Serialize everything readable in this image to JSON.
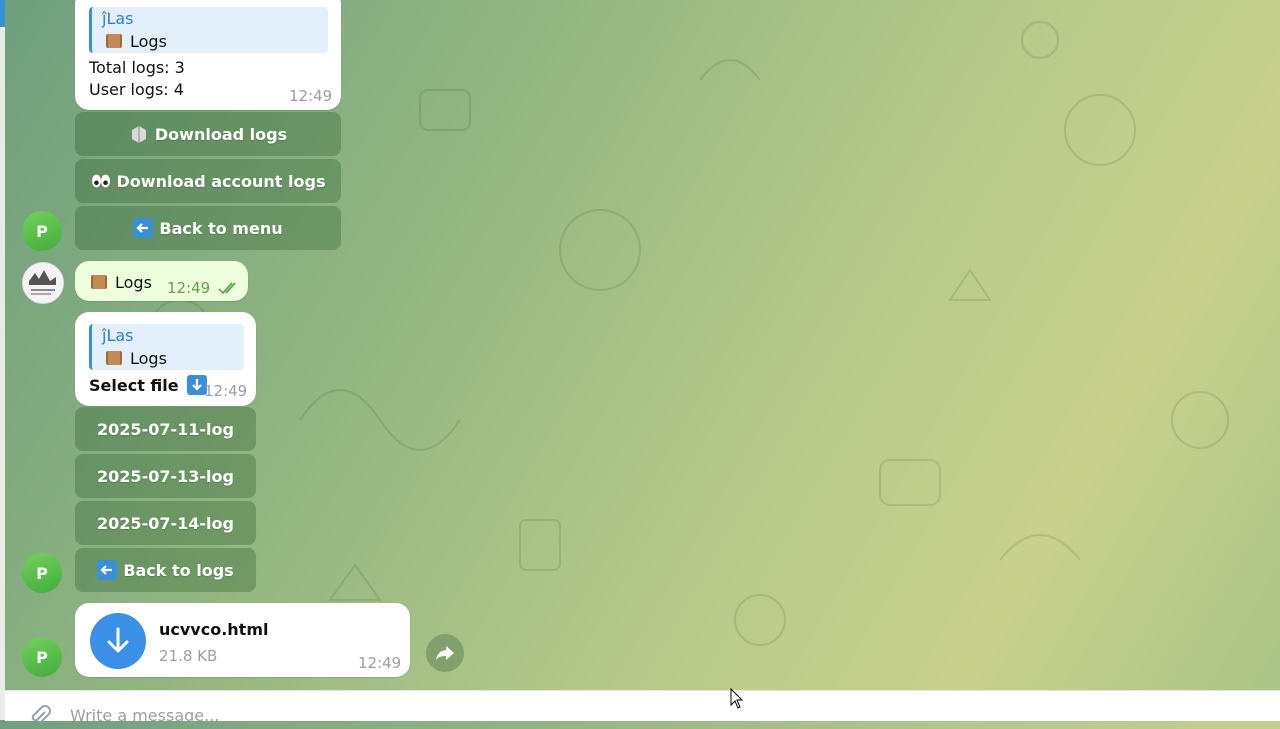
{
  "chat": {
    "msg1": {
      "quote_author": "ĵLas",
      "quote_text": "Logs",
      "line1": "Total logs: 3",
      "line2": "User logs: 4",
      "time": "12:49"
    },
    "keyboard1": [
      {
        "label": "Download logs",
        "icon": "box-icon"
      },
      {
        "label": "Download account logs",
        "icon": "eyes-icon"
      },
      {
        "label": "Back to menu",
        "icon": "back-arrow-icon"
      }
    ],
    "out_msg": {
      "text": "Logs",
      "time": "12:49"
    },
    "msg2": {
      "quote_author": "ĵLas",
      "quote_text": "Logs",
      "text": "Select file",
      "time": "12:49"
    },
    "keyboard2": [
      {
        "label": "2025-07-11-log"
      },
      {
        "label": "2025-07-13-log"
      },
      {
        "label": "2025-07-14-log"
      },
      {
        "label": "Back to logs",
        "icon": "back-arrow-icon"
      }
    ],
    "file": {
      "name": "ucvvco.html",
      "size": "21.8 KB",
      "time": "12:49"
    },
    "avatar_initial": "P"
  },
  "composer": {
    "placeholder": "Write a message..."
  },
  "colors": {
    "accent": "#3a8fd6",
    "bot_avatar": "#4caf50",
    "outgoing": "#eeffde"
  }
}
